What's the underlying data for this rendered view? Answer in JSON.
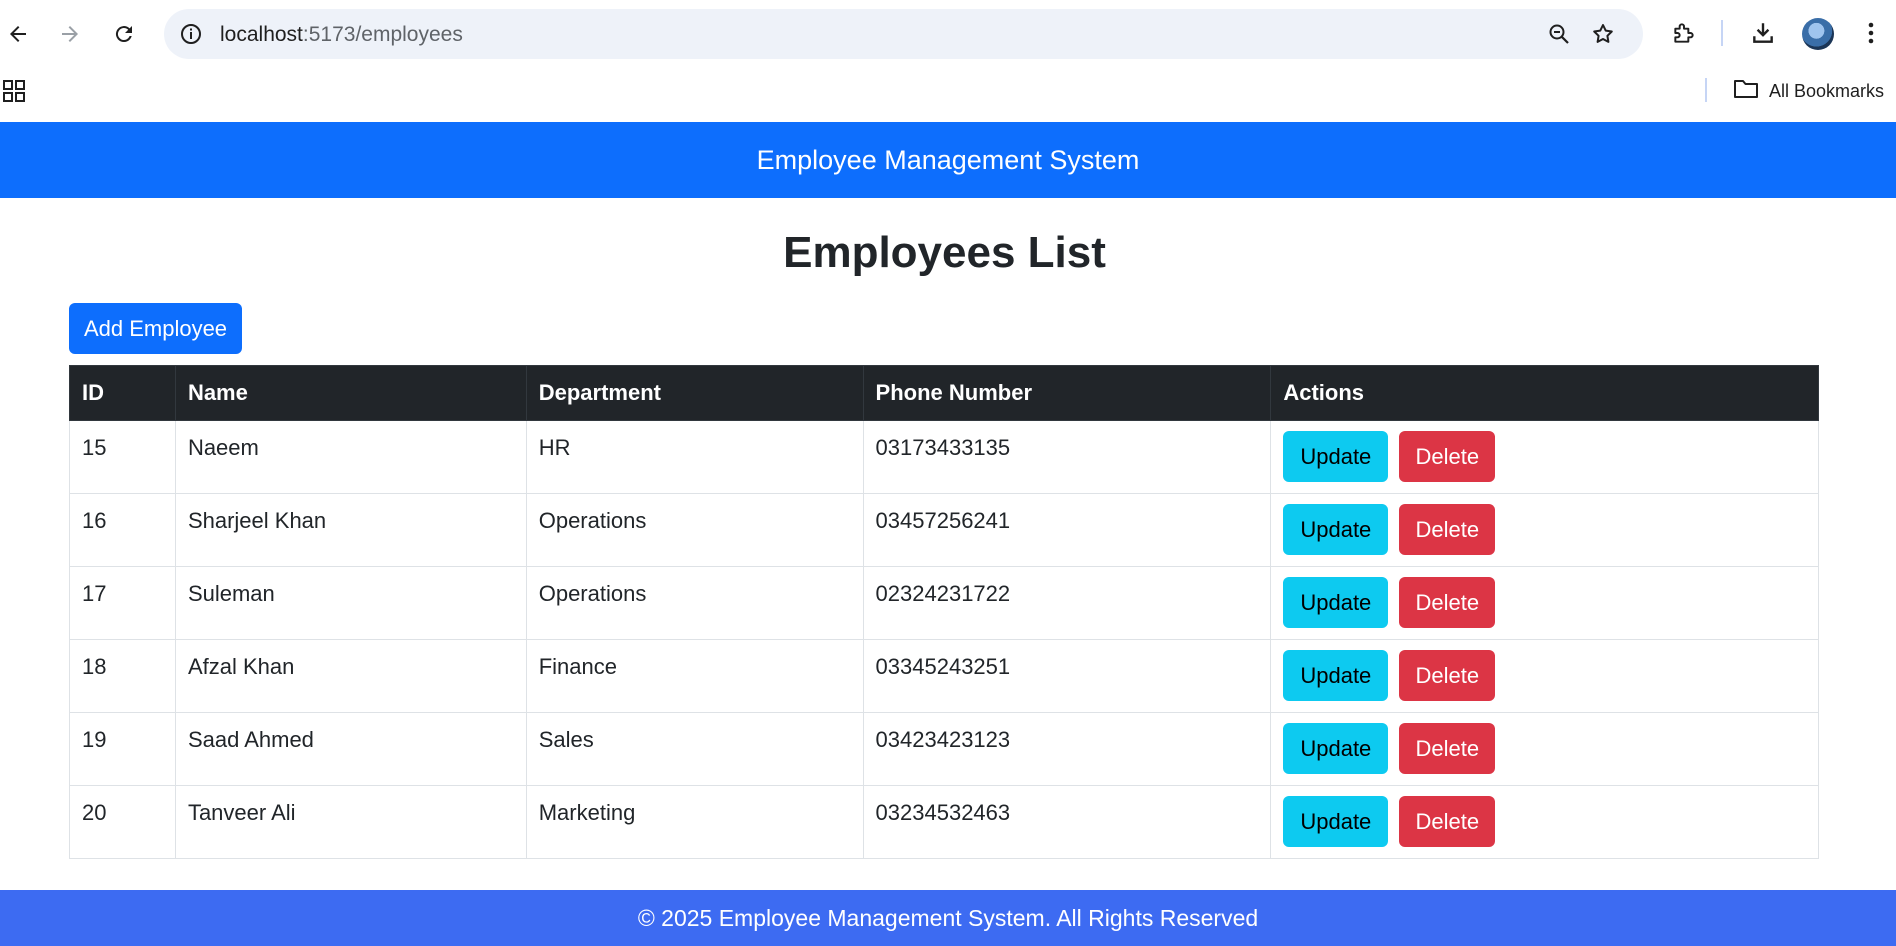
{
  "browser": {
    "url_host": "localhost",
    "url_path": ":5173/employees",
    "bookmarks_label": "All Bookmarks"
  },
  "header": {
    "title": "Employee Management System"
  },
  "page": {
    "title": "Employees List",
    "add_button_label": "Add Employee"
  },
  "table": {
    "columns": [
      "ID",
      "Name",
      "Department",
      "Phone Number",
      "Actions"
    ],
    "rows": [
      {
        "id": "15",
        "name": "Naeem",
        "department": "HR",
        "phone": "03173433135"
      },
      {
        "id": "16",
        "name": "Sharjeel Khan",
        "department": "Operations",
        "phone": "03457256241"
      },
      {
        "id": "17",
        "name": "Suleman",
        "department": "Operations",
        "phone": "02324231722"
      },
      {
        "id": "18",
        "name": "Afzal Khan",
        "department": "Finance",
        "phone": "03345243251"
      },
      {
        "id": "19",
        "name": "Saad Ahmed",
        "department": "Sales",
        "phone": "03423423123"
      },
      {
        "id": "20",
        "name": "Tanveer Ali",
        "department": "Marketing",
        "phone": "03234532463"
      }
    ],
    "update_label": "Update",
    "delete_label": "Delete"
  },
  "footer": {
    "text": "© 2025 Employee Management System. All Rights Reserved"
  },
  "colors": {
    "primary": "#0d6efd",
    "info": "#0dcaf0",
    "danger": "#dc3545",
    "dark": "#212529",
    "footer": "#3d6bf2"
  },
  "icons": [
    "back-arrow-icon",
    "forward-arrow-icon",
    "reload-icon",
    "site-info-icon",
    "zoom-icon",
    "bookmark-star-icon",
    "extensions-icon",
    "download-icon",
    "profile-avatar",
    "kebab-menu-icon",
    "apps-grid-icon",
    "folder-icon"
  ]
}
